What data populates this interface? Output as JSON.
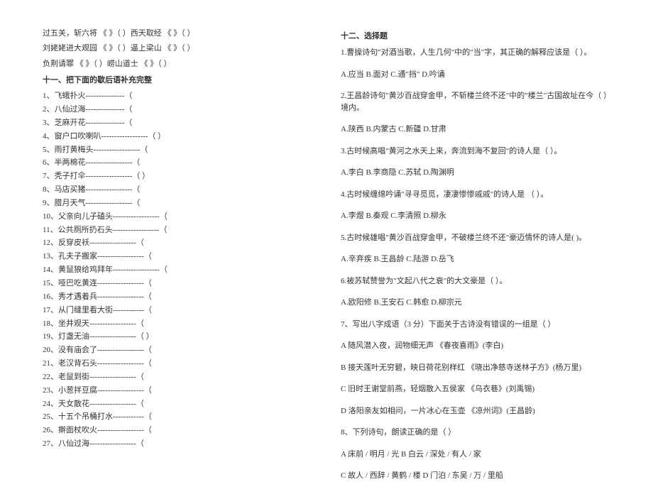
{
  "left": {
    "intro_lines": [
      "过五关，斩六将  《              》（              ）西天取经 《              》（        ）",
      "刘姥姥进大观园 《              》（              ）逼上梁山 《              》（              ）",
      "负荆请罪 《            》（              ）崂山道士 《              》（              ）"
    ],
    "section_title": "十一、把下面的歇后语补充完整",
    "items": [
      "1、飞蛾扑火---------------（",
      "2、八仙过海---------------（",
      "3、芝麻开花---------------（",
      "4、窗户口吹喇叭------------------（              ）",
      "5、雨打黄梅头------------------（",
      "6、半两棉花------------------（",
      "7、秃子打伞------------------（              ）",
      "8、马店买猪------------------（",
      "9、腊月天气------------------（",
      "10、父亲向儿子磕头------------------（",
      "11、公共厕所扔石头------------------（",
      "12、反穿皮袄------------------（",
      "13、孔夫子搬家------------------（",
      "14、黄鼠狼给鸡拜年------------------（",
      "15、哑巴吃黄连------------------（",
      "16、秀才遇着兵------------------（",
      "17、从门缝里看大街------------（",
      "18、坐井观天------------------（",
      "19、灯盏无油------------------（              ）",
      "20、没有庙会了------------------（",
      "21、老汉背石头------------------（",
      "22、老鼠到街------------------（",
      "23、小葱拌豆腐------------------（",
      "24、天女散花------------------（",
      "25、十五个吊桶打水------------（",
      "26、擀面杖吹火------------------（",
      "27、八仙过海------------------（"
    ]
  },
  "right": {
    "section_title": "十二、选择题",
    "questions": [
      {
        "q": "1.曹操诗句\"对酒当歌，人生几何\"中的\"当\"字，其正确的解释应该是（        ）。",
        "opts": "A.应当 B.面对 C.通\"挡\" D.吟诵"
      },
      {
        "q": "2.王昌龄诗句\"黄沙百战穿金甲，不斩楼兰终不还\"中的\"楼兰\"古国故址在今（        ）境内。",
        "opts": "A.陕西 B.内蒙古 C.新疆 D.甘肃"
      },
      {
        "q": "3.古时候高唱\"黄河之水天上来，奔流到海不复回\"的诗人是（        ）。",
        "opts": "A.李白 B.李商隐 C.苏轼 D.陶渊明"
      },
      {
        "q": "4.古时候缠绵吟诵\"寻寻觅觅，凄凄惨惨戚戚\"的诗人是 （        ）。",
        "opts": "A.李煜 B.秦观 C.李清照 D.柳永"
      },
      {
        "q": "5.古时候雄唱\"黄沙百战穿金甲，不破楼兰终不还\"豪迈情怀的诗人是(  )。",
        "opts": "A.辛弃疾 B.王昌龄 C.陆游 D.岳飞"
      },
      {
        "q": "6.被苏轼赞誉为\"文起八代之衰\"的大文豪是（        ）。",
        "opts": "A.欧阳修 B.王安石 C.韩愈 D.柳宗元"
      },
      {
        "q": "7、写出八字成语（3 分）下面关于古诗没有错误的一组是（    ）",
        "opts_multi": [
          "A  随风潜入夜，润物细无声   《春夜喜雨》(李白)",
          "B  接天莲叶无穷碧，映日荷花别样红 《晓出净慈寺送林子方》(杨万里)",
          "C  旧时王谢堂前燕，轻烟散入五侯家   《乌衣巷》(刘禹锡)",
          "D  洛阳亲友如相问，一片冰心在玉壶 《凉州词》(王昌龄)"
        ]
      },
      {
        "q": "8、下列诗句，朗读正确的是（        ）",
        "opts_multi": [
          "A  床前 / 明月 / 光              B  白云 / 深处 / 有人 / 家",
          "C  故人 / 西辞 / 黄鹤 / 楼      D  门泊 / 东吴 / 万 / 里船"
        ]
      }
    ]
  }
}
